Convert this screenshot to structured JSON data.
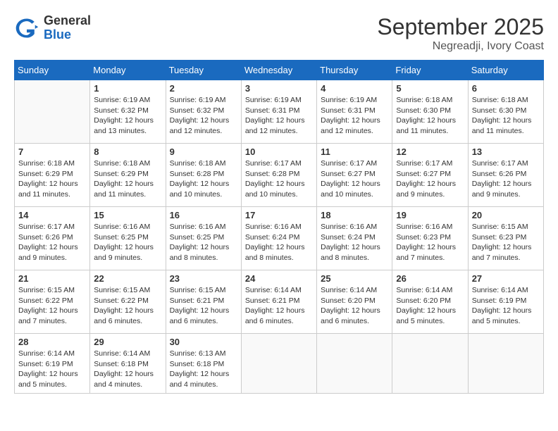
{
  "header": {
    "logo_general": "General",
    "logo_blue": "Blue",
    "month": "September 2025",
    "location": "Negreadji, Ivory Coast"
  },
  "days_of_week": [
    "Sunday",
    "Monday",
    "Tuesday",
    "Wednesday",
    "Thursday",
    "Friday",
    "Saturday"
  ],
  "weeks": [
    [
      {
        "day": "",
        "info": ""
      },
      {
        "day": "1",
        "info": "Sunrise: 6:19 AM\nSunset: 6:32 PM\nDaylight: 12 hours\nand 13 minutes."
      },
      {
        "day": "2",
        "info": "Sunrise: 6:19 AM\nSunset: 6:32 PM\nDaylight: 12 hours\nand 12 minutes."
      },
      {
        "day": "3",
        "info": "Sunrise: 6:19 AM\nSunset: 6:31 PM\nDaylight: 12 hours\nand 12 minutes."
      },
      {
        "day": "4",
        "info": "Sunrise: 6:19 AM\nSunset: 6:31 PM\nDaylight: 12 hours\nand 12 minutes."
      },
      {
        "day": "5",
        "info": "Sunrise: 6:18 AM\nSunset: 6:30 PM\nDaylight: 12 hours\nand 11 minutes."
      },
      {
        "day": "6",
        "info": "Sunrise: 6:18 AM\nSunset: 6:30 PM\nDaylight: 12 hours\nand 11 minutes."
      }
    ],
    [
      {
        "day": "7",
        "info": "Sunrise: 6:18 AM\nSunset: 6:29 PM\nDaylight: 12 hours\nand 11 minutes."
      },
      {
        "day": "8",
        "info": "Sunrise: 6:18 AM\nSunset: 6:29 PM\nDaylight: 12 hours\nand 11 minutes."
      },
      {
        "day": "9",
        "info": "Sunrise: 6:18 AM\nSunset: 6:28 PM\nDaylight: 12 hours\nand 10 minutes."
      },
      {
        "day": "10",
        "info": "Sunrise: 6:17 AM\nSunset: 6:28 PM\nDaylight: 12 hours\nand 10 minutes."
      },
      {
        "day": "11",
        "info": "Sunrise: 6:17 AM\nSunset: 6:27 PM\nDaylight: 12 hours\nand 10 minutes."
      },
      {
        "day": "12",
        "info": "Sunrise: 6:17 AM\nSunset: 6:27 PM\nDaylight: 12 hours\nand 9 minutes."
      },
      {
        "day": "13",
        "info": "Sunrise: 6:17 AM\nSunset: 6:26 PM\nDaylight: 12 hours\nand 9 minutes."
      }
    ],
    [
      {
        "day": "14",
        "info": "Sunrise: 6:17 AM\nSunset: 6:26 PM\nDaylight: 12 hours\nand 9 minutes."
      },
      {
        "day": "15",
        "info": "Sunrise: 6:16 AM\nSunset: 6:25 PM\nDaylight: 12 hours\nand 9 minutes."
      },
      {
        "day": "16",
        "info": "Sunrise: 6:16 AM\nSunset: 6:25 PM\nDaylight: 12 hours\nand 8 minutes."
      },
      {
        "day": "17",
        "info": "Sunrise: 6:16 AM\nSunset: 6:24 PM\nDaylight: 12 hours\nand 8 minutes."
      },
      {
        "day": "18",
        "info": "Sunrise: 6:16 AM\nSunset: 6:24 PM\nDaylight: 12 hours\nand 8 minutes."
      },
      {
        "day": "19",
        "info": "Sunrise: 6:16 AM\nSunset: 6:23 PM\nDaylight: 12 hours\nand 7 minutes."
      },
      {
        "day": "20",
        "info": "Sunrise: 6:15 AM\nSunset: 6:23 PM\nDaylight: 12 hours\nand 7 minutes."
      }
    ],
    [
      {
        "day": "21",
        "info": "Sunrise: 6:15 AM\nSunset: 6:22 PM\nDaylight: 12 hours\nand 7 minutes."
      },
      {
        "day": "22",
        "info": "Sunrise: 6:15 AM\nSunset: 6:22 PM\nDaylight: 12 hours\nand 6 minutes."
      },
      {
        "day": "23",
        "info": "Sunrise: 6:15 AM\nSunset: 6:21 PM\nDaylight: 12 hours\nand 6 minutes."
      },
      {
        "day": "24",
        "info": "Sunrise: 6:14 AM\nSunset: 6:21 PM\nDaylight: 12 hours\nand 6 minutes."
      },
      {
        "day": "25",
        "info": "Sunrise: 6:14 AM\nSunset: 6:20 PM\nDaylight: 12 hours\nand 6 minutes."
      },
      {
        "day": "26",
        "info": "Sunrise: 6:14 AM\nSunset: 6:20 PM\nDaylight: 12 hours\nand 5 minutes."
      },
      {
        "day": "27",
        "info": "Sunrise: 6:14 AM\nSunset: 6:19 PM\nDaylight: 12 hours\nand 5 minutes."
      }
    ],
    [
      {
        "day": "28",
        "info": "Sunrise: 6:14 AM\nSunset: 6:19 PM\nDaylight: 12 hours\nand 5 minutes."
      },
      {
        "day": "29",
        "info": "Sunrise: 6:14 AM\nSunset: 6:18 PM\nDaylight: 12 hours\nand 4 minutes."
      },
      {
        "day": "30",
        "info": "Sunrise: 6:13 AM\nSunset: 6:18 PM\nDaylight: 12 hours\nand 4 minutes."
      },
      {
        "day": "",
        "info": ""
      },
      {
        "day": "",
        "info": ""
      },
      {
        "day": "",
        "info": ""
      },
      {
        "day": "",
        "info": ""
      }
    ]
  ]
}
